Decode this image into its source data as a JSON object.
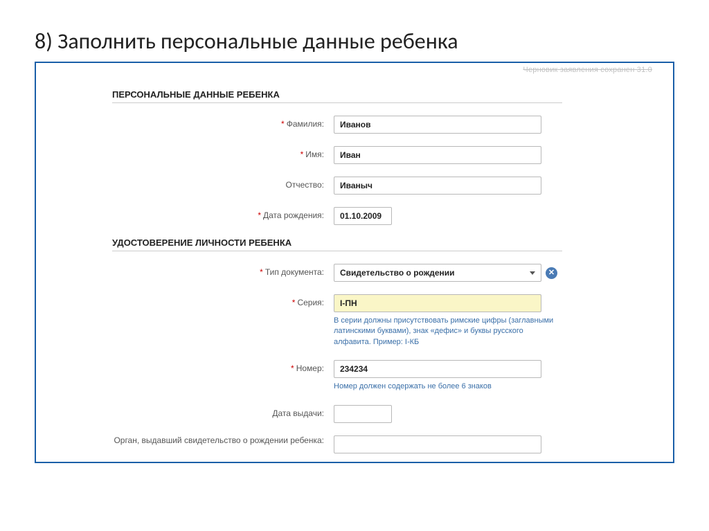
{
  "slide": {
    "title": "8) Заполнить персональные данные ребенка"
  },
  "draft_note": "Черновик заявления сохранен 31.0",
  "sections": {
    "personal": {
      "header": "ПЕРСОНАЛЬНЫЕ ДАННЫЕ РЕБЕНКА",
      "lastname_label": "Фамилия:",
      "lastname_value": "Иванов",
      "firstname_label": "Имя:",
      "firstname_value": "Иван",
      "patronymic_label": "Отчество:",
      "patronymic_value": "Иваныч",
      "dob_label": "Дата рождения:",
      "dob_value": "01.10.2009"
    },
    "identity": {
      "header": "УДОСТОВЕРЕНИЕ ЛИЧНОСТИ РЕБЕНКА",
      "doctype_label": "Тип документа:",
      "doctype_value": "Свидетельство о рождении",
      "series_label": "Серия:",
      "series_value": "I-ПН",
      "series_hint": "В серии должны присутствовать римские цифры (заглавными латинскими буквами), знак «дефис» и буквы русского алфавита. Пример: I-КБ",
      "number_label": "Номер:",
      "number_value": "234234",
      "number_hint": "Номер должен содержать не более 6 знаков",
      "issue_date_label": "Дата выдачи:",
      "issue_date_value": "",
      "issuer_label": "Орган, выдавший свидетельство о рождении ребенка:",
      "issuer_value": ""
    }
  }
}
